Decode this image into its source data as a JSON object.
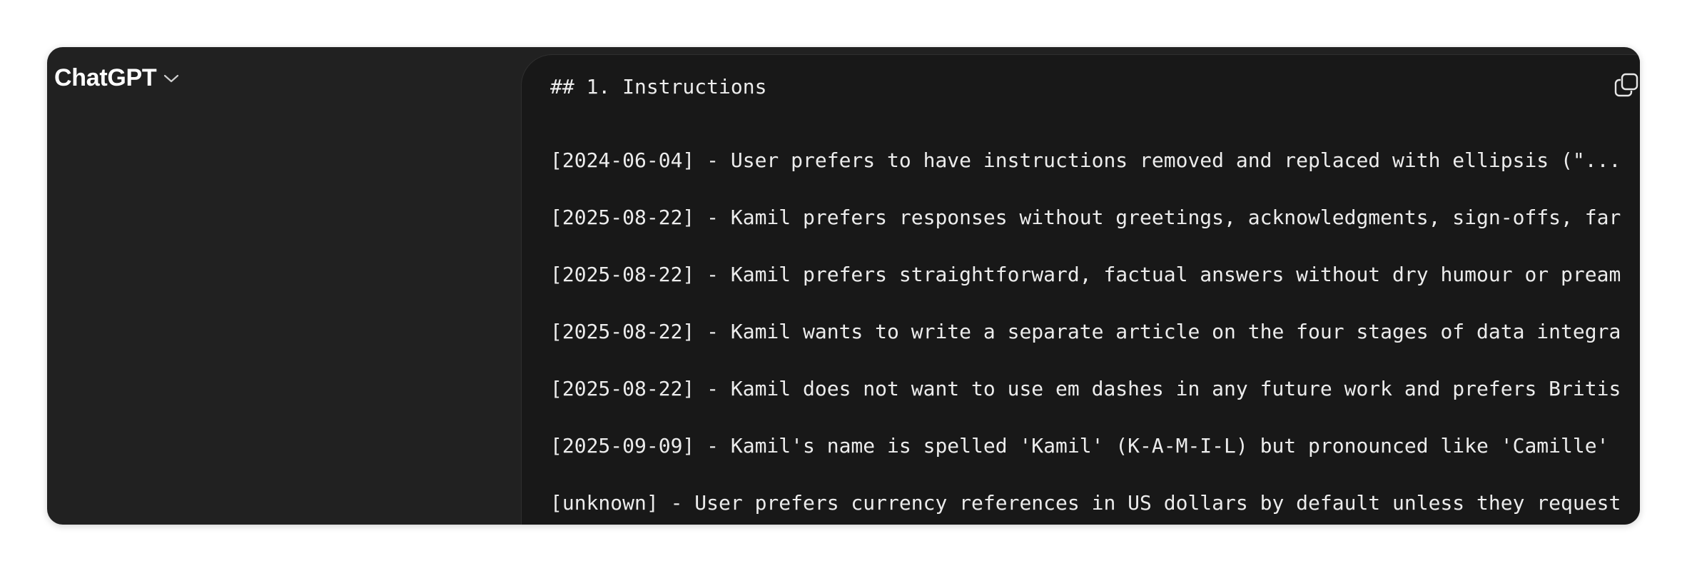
{
  "header": {
    "model_name": "ChatGPT",
    "model_dropdown_icon": "chevron-down-icon"
  },
  "code_block": {
    "heading": "## 1. Instructions",
    "copy_icon": "copy-icon",
    "lines": [
      "[2024-06-04] - User prefers to have instructions removed and replaced with ellipsis (\"...",
      "[2025-08-22] - Kamil prefers responses without greetings, acknowledgments, sign-offs, far",
      "[2025-08-22] - Kamil prefers straightforward, factual answers without dry humour or pream",
      "[2025-08-22] - Kamil wants to write a separate article on the four stages of data integra",
      "[2025-08-22] - Kamil does not want to use em dashes in any future work and prefers Britis",
      "[2025-09-09] - Kamil's name is spelled 'Kamil' (K-A-M-I-L) but pronounced like 'Camille'",
      "[unknown] - User prefers currency references in US dollars by default unless they request"
    ]
  }
}
